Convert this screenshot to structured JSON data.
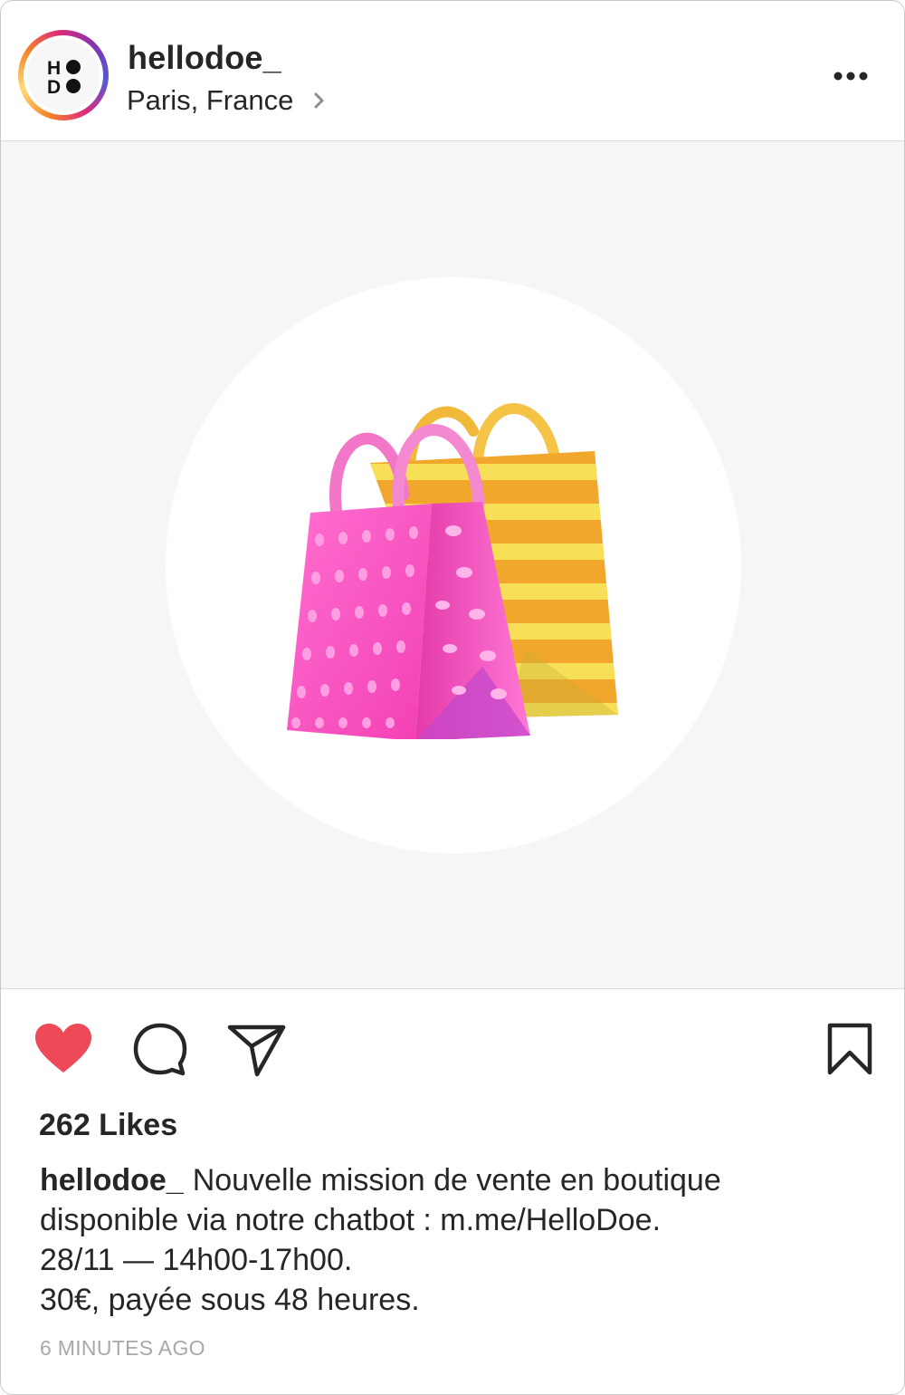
{
  "post": {
    "username": "hellodoe_",
    "location": "Paris, France",
    "avatar_letters": [
      "H",
      "D"
    ],
    "likes_text": "262 Likes",
    "caption": {
      "username": "hellodoe_",
      "line1": "Nouvelle mission de vente en boutique",
      "line2": "disponible via notre chatbot : m.me/HelloDoe.",
      "line3": "28/11 — 14h00-17h00.",
      "line4": "30€, payée sous 48 heures."
    },
    "timestamp": "6 MINUTES AGO",
    "liked": true
  },
  "icons": {
    "more": "more-options-icon",
    "chevron": "chevron-right-icon",
    "like": "heart-icon",
    "comment": "comment-icon",
    "share": "paper-plane-icon",
    "save": "bookmark-icon",
    "media": "shopping-bags-emoji"
  },
  "colors": {
    "heart": "#ed4956",
    "media_background": "#f5f6f8",
    "text": "#262626",
    "muted": "#a8a8a8"
  }
}
